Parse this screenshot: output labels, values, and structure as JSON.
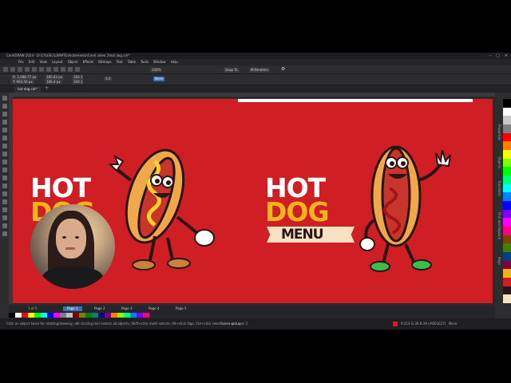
{
  "window": {
    "title": "CorelDRAW 2024 - D:\\CYLEEC\\LEMATE\\Andamento\\Corel video 2\\hot dog.cdr*"
  },
  "menu": [
    "File",
    "Edit",
    "View",
    "Layout",
    "Object",
    "Effects",
    "Bitmaps",
    "Text",
    "Table",
    "Tools",
    "Window",
    "Help"
  ],
  "toolbar": {
    "zoom": "144%",
    "snap": "Snap To",
    "units": "Millimeters",
    "x": "X: 1,688.77 px",
    "y": "Y: 993.50 px",
    "w": "185.62 px",
    "h": "186.4 px",
    "sx": "100.1",
    "sy": "100.1",
    "angle": "0.0",
    "outline": "None"
  },
  "document_tab": "hot dog.cdr*",
  "artwork": {
    "left_hot": "HOT",
    "left_dog": "DOG",
    "right_hot": "HOT",
    "right_dog": "DOG",
    "right_menu": "MENU",
    "colors": {
      "bg": "#d01f24",
      "white": "#ffffff",
      "yellow": "#f0b51b",
      "banner": "#f6e2c2",
      "dark": "#2a1414"
    }
  },
  "pages": {
    "info": "1 of 5",
    "tabs": [
      "Page 1",
      "Page 2",
      "Page 3",
      "Page 4",
      "Page 5"
    ],
    "active": 0
  },
  "status": {
    "hint": "Click an object twice for rotating/skewing; dbl-clicking tool selects all objects; Shift+click multi-selects; Alt+click digs; Ctrl+click selects in a group",
    "layer": "Curve on Layer 1",
    "color_info": "R:214 G:30 B:39 (#D61E27)",
    "outline": "None"
  },
  "dockers": [
    "Properties",
    "Objects",
    "Transform",
    "Find and Replace",
    "Align"
  ],
  "palette_colors": [
    "#000000",
    "#ffffff",
    "#c8c8c8",
    "#808080",
    "#ff0000",
    "#ff8000",
    "#ffff00",
    "#80ff00",
    "#00ff00",
    "#00ff80",
    "#00ffff",
    "#0080ff",
    "#0000ff",
    "#8000ff",
    "#ff00ff",
    "#ff0080",
    "#804000",
    "#408000",
    "#004080",
    "#800040",
    "#f0b51b",
    "#d01f24",
    "#2a1414",
    "#f6e2c2"
  ],
  "strip_colors": [
    "#000000",
    "#ffffff",
    "#ff0000",
    "#ffff00",
    "#00ff00",
    "#00ffff",
    "#0000ff",
    "#ff00ff",
    "#808080",
    "#c0c0c0",
    "#800000",
    "#808000",
    "#008000",
    "#008080",
    "#000080",
    "#800080",
    "#ff8000",
    "#80ff00",
    "#00ff80",
    "#0080ff",
    "#8000ff",
    "#ff0080"
  ]
}
